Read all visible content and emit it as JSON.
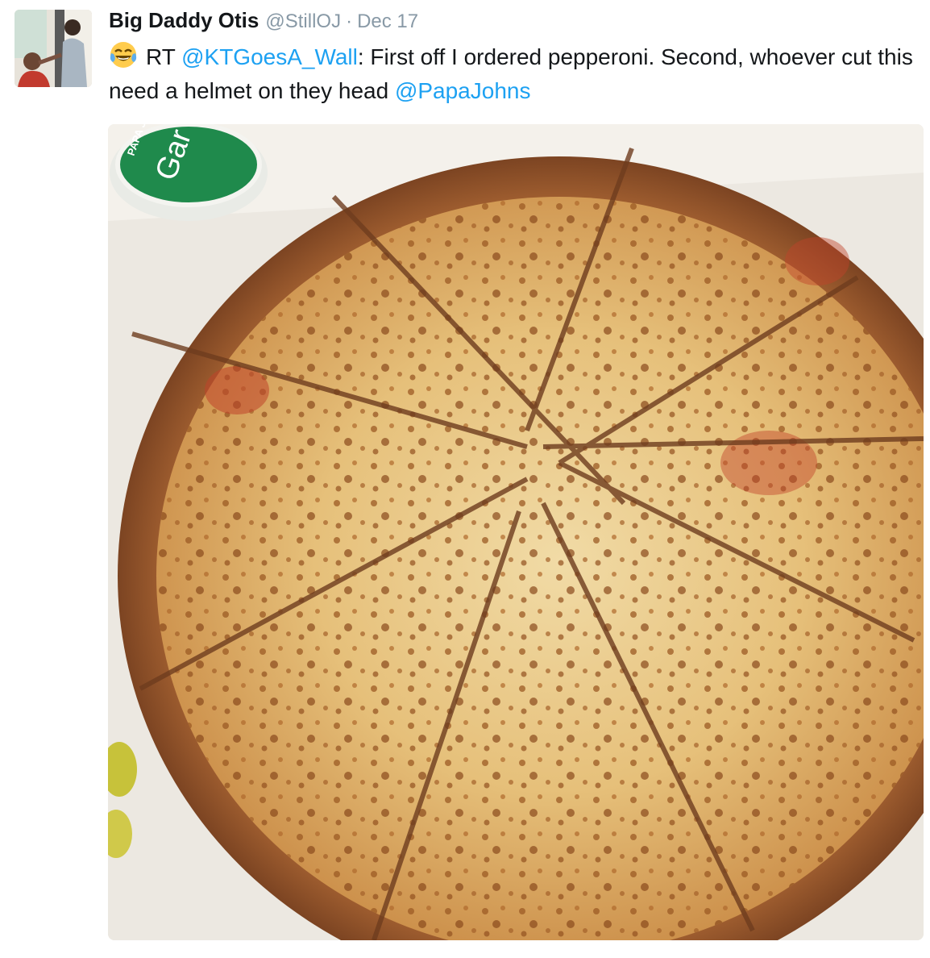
{
  "tweet": {
    "author_name": "Big Daddy Otis",
    "handle": "@StillOJ",
    "separator": "·",
    "date": "Dec 17",
    "emoji_icon": "face-with-tears-of-joy-icon",
    "text": {
      "rt_prefix": "RT ",
      "mention_1": "@KTGoesA_Wall",
      "line": ": First off I ordered pepperoni. Second, whoever cut this need a helmet on they head ",
      "mention_2": "@PapaJohns"
    }
  },
  "media": {
    "sauce_cup_label": "Gar",
    "sauce_cup_brand": "PAPA JOHNS"
  },
  "colors": {
    "mention": "#1da1f2",
    "name": "#14171a",
    "meta": "#8899a6"
  }
}
